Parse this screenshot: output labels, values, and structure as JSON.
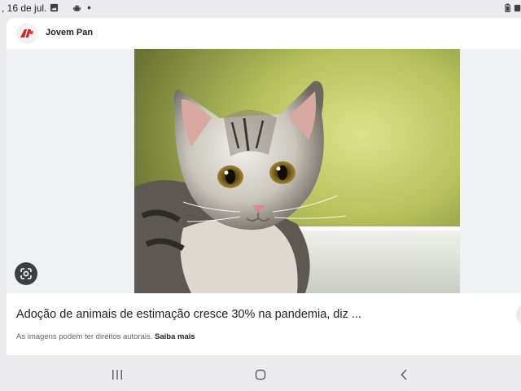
{
  "status_bar": {
    "time_text": ", 16 de jul.",
    "icons": [
      "gallery-icon",
      "android-icon",
      "notification-dot-icon",
      "battery-icon",
      "battery-saver-icon"
    ]
  },
  "card": {
    "source": {
      "name": "Jovem Pan",
      "logo_icon": "jovem-pan-logo",
      "brand_color": "#d0262b"
    },
    "image_icon": "kitten-photo",
    "lens_icon": "google-lens-icon",
    "headline": "Adoção de animais de estimação cresce 30% na pandemia, diz ...",
    "copyright_notice": "As imagens podem ter direitos autorais.",
    "learn_more": "Saiba mais"
  },
  "nav_bar": {
    "icons": [
      "recent-apps-icon",
      "home-icon",
      "back-icon"
    ]
  },
  "colors": {
    "background": "#ececee",
    "card": "#ffffff",
    "text_primary": "#202124",
    "text_secondary": "#5f6368"
  }
}
